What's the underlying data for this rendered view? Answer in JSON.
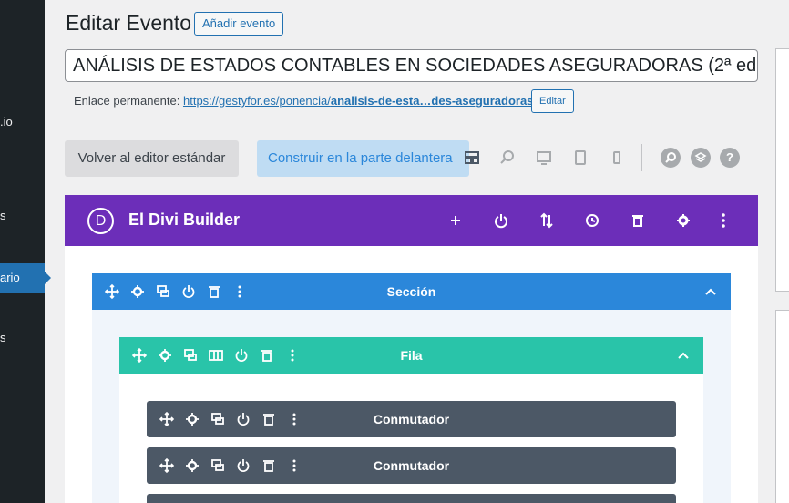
{
  "sidebar": {
    "items": [
      {
        "label": ".io"
      },
      {
        "label": "s"
      },
      {
        "label": "ario"
      },
      {
        "label": "s"
      }
    ]
  },
  "header": {
    "title": "Editar Evento",
    "add_new_label": "Añadir evento"
  },
  "post": {
    "title_value": "ANÁLISIS DE ESTADOS CONTABLES EN SOCIEDADES ASEGURADORAS (2ª ed",
    "permalink_label": "Enlace permanente:",
    "permalink_base": "https://gestyfor.es/ponencia/",
    "permalink_slug": "analisis-de-esta…des-aseguradoras",
    "permalink_end": "/",
    "edit_label": "Editar"
  },
  "editor": {
    "standard_label": "Volver al editor estándar",
    "frontend_label": "Construir en la parte delantera"
  },
  "divi": {
    "logo_letter": "D",
    "title": "El Divi Builder",
    "section_label": "Sección",
    "row_label": "Fila",
    "modules": [
      {
        "label": "Conmutador"
      },
      {
        "label": "Conmutador"
      }
    ]
  },
  "colors": {
    "divi_purple": "#6c2eb9",
    "section_blue": "#2b87da",
    "row_green": "#29c4a9",
    "module_gray": "#4c5866"
  }
}
